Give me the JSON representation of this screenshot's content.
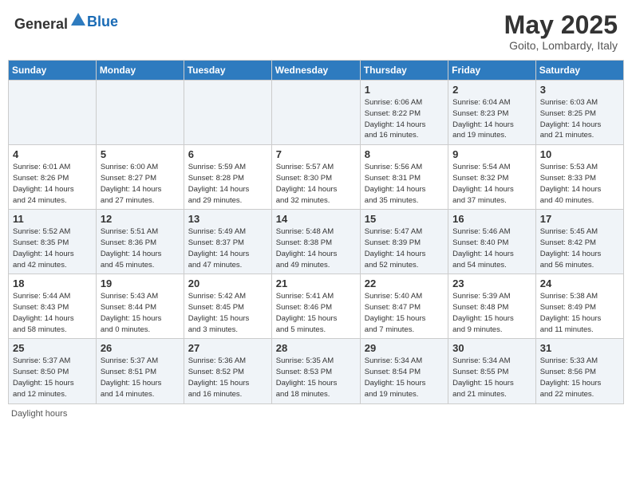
{
  "header": {
    "logo_general": "General",
    "logo_blue": "Blue",
    "month": "May 2025",
    "location": "Goito, Lombardy, Italy"
  },
  "days_of_week": [
    "Sunday",
    "Monday",
    "Tuesday",
    "Wednesday",
    "Thursday",
    "Friday",
    "Saturday"
  ],
  "weeks": [
    [
      {
        "day": "",
        "info": ""
      },
      {
        "day": "",
        "info": ""
      },
      {
        "day": "",
        "info": ""
      },
      {
        "day": "",
        "info": ""
      },
      {
        "day": "1",
        "info": "Sunrise: 6:06 AM\nSunset: 8:22 PM\nDaylight: 14 hours\nand 16 minutes."
      },
      {
        "day": "2",
        "info": "Sunrise: 6:04 AM\nSunset: 8:23 PM\nDaylight: 14 hours\nand 19 minutes."
      },
      {
        "day": "3",
        "info": "Sunrise: 6:03 AM\nSunset: 8:25 PM\nDaylight: 14 hours\nand 21 minutes."
      }
    ],
    [
      {
        "day": "4",
        "info": "Sunrise: 6:01 AM\nSunset: 8:26 PM\nDaylight: 14 hours\nand 24 minutes."
      },
      {
        "day": "5",
        "info": "Sunrise: 6:00 AM\nSunset: 8:27 PM\nDaylight: 14 hours\nand 27 minutes."
      },
      {
        "day": "6",
        "info": "Sunrise: 5:59 AM\nSunset: 8:28 PM\nDaylight: 14 hours\nand 29 minutes."
      },
      {
        "day": "7",
        "info": "Sunrise: 5:57 AM\nSunset: 8:30 PM\nDaylight: 14 hours\nand 32 minutes."
      },
      {
        "day": "8",
        "info": "Sunrise: 5:56 AM\nSunset: 8:31 PM\nDaylight: 14 hours\nand 35 minutes."
      },
      {
        "day": "9",
        "info": "Sunrise: 5:54 AM\nSunset: 8:32 PM\nDaylight: 14 hours\nand 37 minutes."
      },
      {
        "day": "10",
        "info": "Sunrise: 5:53 AM\nSunset: 8:33 PM\nDaylight: 14 hours\nand 40 minutes."
      }
    ],
    [
      {
        "day": "11",
        "info": "Sunrise: 5:52 AM\nSunset: 8:35 PM\nDaylight: 14 hours\nand 42 minutes."
      },
      {
        "day": "12",
        "info": "Sunrise: 5:51 AM\nSunset: 8:36 PM\nDaylight: 14 hours\nand 45 minutes."
      },
      {
        "day": "13",
        "info": "Sunrise: 5:49 AM\nSunset: 8:37 PM\nDaylight: 14 hours\nand 47 minutes."
      },
      {
        "day": "14",
        "info": "Sunrise: 5:48 AM\nSunset: 8:38 PM\nDaylight: 14 hours\nand 49 minutes."
      },
      {
        "day": "15",
        "info": "Sunrise: 5:47 AM\nSunset: 8:39 PM\nDaylight: 14 hours\nand 52 minutes."
      },
      {
        "day": "16",
        "info": "Sunrise: 5:46 AM\nSunset: 8:40 PM\nDaylight: 14 hours\nand 54 minutes."
      },
      {
        "day": "17",
        "info": "Sunrise: 5:45 AM\nSunset: 8:42 PM\nDaylight: 14 hours\nand 56 minutes."
      }
    ],
    [
      {
        "day": "18",
        "info": "Sunrise: 5:44 AM\nSunset: 8:43 PM\nDaylight: 14 hours\nand 58 minutes."
      },
      {
        "day": "19",
        "info": "Sunrise: 5:43 AM\nSunset: 8:44 PM\nDaylight: 15 hours\nand 0 minutes."
      },
      {
        "day": "20",
        "info": "Sunrise: 5:42 AM\nSunset: 8:45 PM\nDaylight: 15 hours\nand 3 minutes."
      },
      {
        "day": "21",
        "info": "Sunrise: 5:41 AM\nSunset: 8:46 PM\nDaylight: 15 hours\nand 5 minutes."
      },
      {
        "day": "22",
        "info": "Sunrise: 5:40 AM\nSunset: 8:47 PM\nDaylight: 15 hours\nand 7 minutes."
      },
      {
        "day": "23",
        "info": "Sunrise: 5:39 AM\nSunset: 8:48 PM\nDaylight: 15 hours\nand 9 minutes."
      },
      {
        "day": "24",
        "info": "Sunrise: 5:38 AM\nSunset: 8:49 PM\nDaylight: 15 hours\nand 11 minutes."
      }
    ],
    [
      {
        "day": "25",
        "info": "Sunrise: 5:37 AM\nSunset: 8:50 PM\nDaylight: 15 hours\nand 12 minutes."
      },
      {
        "day": "26",
        "info": "Sunrise: 5:37 AM\nSunset: 8:51 PM\nDaylight: 15 hours\nand 14 minutes."
      },
      {
        "day": "27",
        "info": "Sunrise: 5:36 AM\nSunset: 8:52 PM\nDaylight: 15 hours\nand 16 minutes."
      },
      {
        "day": "28",
        "info": "Sunrise: 5:35 AM\nSunset: 8:53 PM\nDaylight: 15 hours\nand 18 minutes."
      },
      {
        "day": "29",
        "info": "Sunrise: 5:34 AM\nSunset: 8:54 PM\nDaylight: 15 hours\nand 19 minutes."
      },
      {
        "day": "30",
        "info": "Sunrise: 5:34 AM\nSunset: 8:55 PM\nDaylight: 15 hours\nand 21 minutes."
      },
      {
        "day": "31",
        "info": "Sunrise: 5:33 AM\nSunset: 8:56 PM\nDaylight: 15 hours\nand 22 minutes."
      }
    ]
  ],
  "footer": {
    "daylight_label": "Daylight hours"
  }
}
